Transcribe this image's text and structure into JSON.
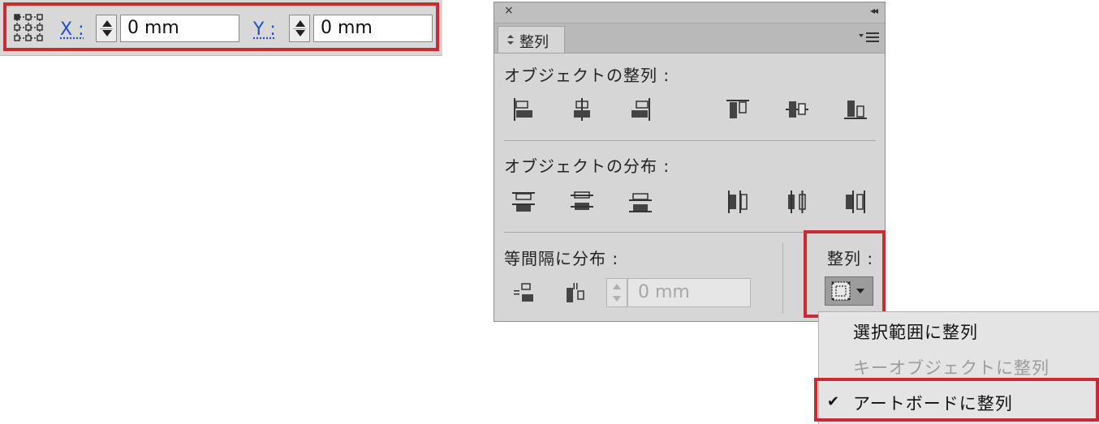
{
  "control_bar": {
    "x_label": "X :",
    "x_value": "0 mm",
    "y_label": "Y :",
    "y_value": "0 mm"
  },
  "panel": {
    "close_glyph": "×",
    "collapse_glyph": "◂◂",
    "tab_label": "整列",
    "align_objects_title": "オブジェクトの整列 :",
    "distribute_objects_title": "オブジェクトの分布 :",
    "distribute_spacing_title": "等間隔に分布 :",
    "spacing_value": "0 mm",
    "align_to_title": "整列 :"
  },
  "align_menu": {
    "items": [
      {
        "label": "選択範囲に整列",
        "enabled": true,
        "checked": false
      },
      {
        "label": "キーオブジェクトに整列",
        "enabled": false,
        "checked": false
      },
      {
        "label": "アートボードに整列",
        "enabled": true,
        "checked": true
      }
    ],
    "check_glyph": "✔"
  },
  "colors": {
    "highlight": "#cc2a33",
    "panel_bg": "#d6d6d6",
    "axis_link": "#1f4fd1"
  },
  "icons": [
    "reference-point-icon",
    "stepper-icon",
    "horizontal-align-left-icon",
    "horizontal-align-center-icon",
    "horizontal-align-right-icon",
    "vertical-align-top-icon",
    "vertical-align-center-icon",
    "vertical-align-bottom-icon",
    "vertical-distribute-top-icon",
    "vertical-distribute-center-icon",
    "vertical-distribute-bottom-icon",
    "horizontal-distribute-left-icon",
    "horizontal-distribute-center-icon",
    "horizontal-distribute-right-icon",
    "vertical-distribute-space-icon",
    "horizontal-distribute-space-icon",
    "align-to-artboard-icon",
    "panel-menu-icon",
    "checkmark-icon"
  ]
}
